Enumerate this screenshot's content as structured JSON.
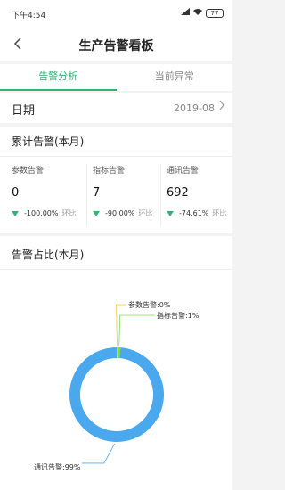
{
  "status_bar": {
    "time": "下午4:54",
    "battery": "77"
  },
  "nav": {
    "title": "生产告警看板"
  },
  "tabs": [
    {
      "label": "告警分析"
    },
    {
      "label": "当前异常"
    }
  ],
  "date": {
    "label": "日期",
    "value": "2019-08"
  },
  "cumulative": {
    "title": "累计告警(本月)",
    "cards": [
      {
        "name": "参数告警",
        "count": "0",
        "change": "-100.00%",
        "compare_label": "环比"
      },
      {
        "name": "指标告警",
        "count": "7",
        "change": "-90.00%",
        "compare_label": "环比"
      },
      {
        "name": "通讯告警",
        "count": "692",
        "change": "-74.61%",
        "compare_label": "环比"
      }
    ]
  },
  "ratio": {
    "title": "告警占比(本月)"
  },
  "colors": {
    "accent": "#2bb673",
    "comm": "#4aa8ee",
    "index": "#7dd65b",
    "param": "#f5c542"
  },
  "chart_data": {
    "type": "pie",
    "title": "告警占比(本月)",
    "slices": [
      {
        "name": "参数告警",
        "value": 0,
        "label": "参数告警:0%"
      },
      {
        "name": "指标告警",
        "value": 1,
        "label": "指标告警:1%"
      },
      {
        "name": "通讯告警",
        "value": 99,
        "label": "通讯告警:99%"
      }
    ]
  }
}
